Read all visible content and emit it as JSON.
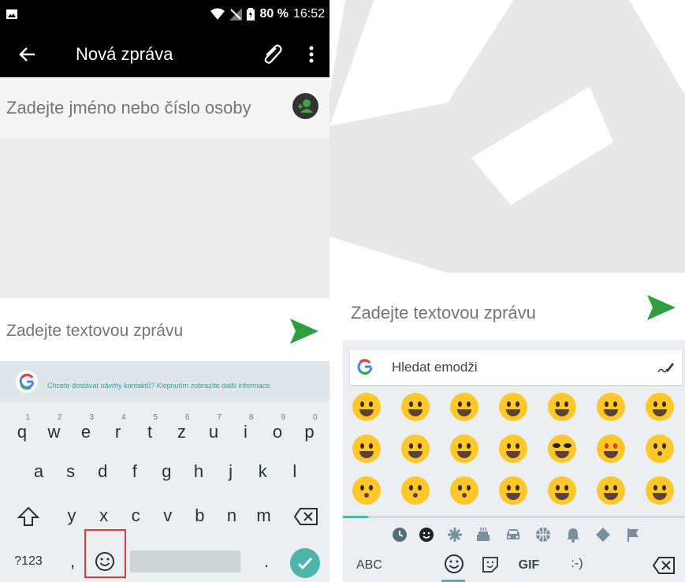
{
  "status_bar": {
    "battery": "80 %",
    "time": "16:52"
  },
  "app_bar": {
    "title": "Nová zpráva"
  },
  "recipient": {
    "placeholder": "Zadejte jméno nebo číslo osoby"
  },
  "compose": {
    "placeholder": "Zadejte textovou zprávu"
  },
  "suggestion_bar": {
    "text": "Chcete dostávat návrhy kontaktů? Klepnutím zobrazíte další informace."
  },
  "keyboard": {
    "row1": [
      {
        "key": "q",
        "hint": "1"
      },
      {
        "key": "w",
        "hint": "2"
      },
      {
        "key": "e",
        "hint": "3"
      },
      {
        "key": "r",
        "hint": "4"
      },
      {
        "key": "t",
        "hint": "5"
      },
      {
        "key": "z",
        "hint": "6"
      },
      {
        "key": "u",
        "hint": "7"
      },
      {
        "key": "i",
        "hint": "8"
      },
      {
        "key": "o",
        "hint": "9"
      },
      {
        "key": "p",
        "hint": "0"
      }
    ],
    "row2": [
      "a",
      "s",
      "d",
      "f",
      "g",
      "h",
      "j",
      "k",
      "l"
    ],
    "row3": [
      "y",
      "x",
      "c",
      "v",
      "b",
      "n",
      "m"
    ],
    "symbols_label": "?123",
    "comma": ",",
    "period": "."
  },
  "emoji_panel": {
    "compose_placeholder": "Zadejte textovou zprávu",
    "search_placeholder": "Hledat emodži",
    "abc_label": "ABC",
    "gif_label": "GIF",
    "emoticon_label": ":-)"
  },
  "colors": {
    "accent": "#4db6ac",
    "send": "#2e9e3f",
    "highlight": "#e53935",
    "emoji": "#ffc829"
  }
}
